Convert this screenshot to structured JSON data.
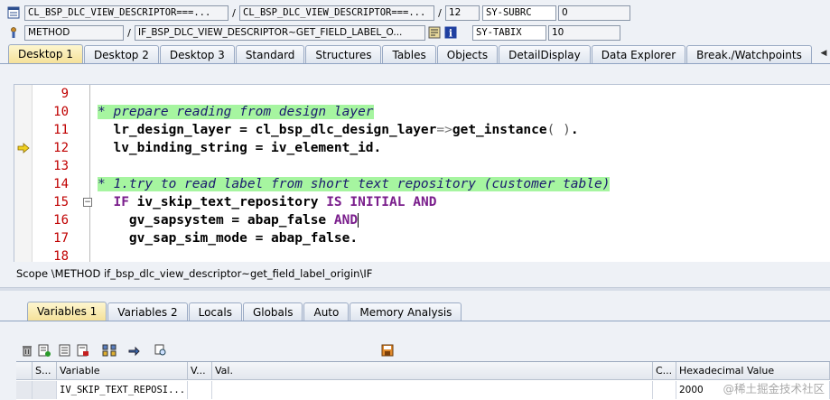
{
  "header": {
    "row1": {
      "program": "CL_BSP_DLC_VIEW_DESCRIPTOR===...",
      "include": "CL_BSP_DLC_VIEW_DESCRIPTOR===...",
      "line": "12",
      "var_name": "SY-SUBRC",
      "var_value": "0"
    },
    "row2": {
      "event_type": "METHOD",
      "event_name": "IF_BSP_DLC_VIEW_DESCRIPTOR~GET_FIELD_LABEL_O...",
      "var_name": "SY-TABIX",
      "var_value": "10"
    },
    "separator": "/"
  },
  "main_tabs": [
    {
      "label": "Desktop 1",
      "active": true
    },
    {
      "label": "Desktop 2",
      "active": false
    },
    {
      "label": "Desktop 3",
      "active": false
    },
    {
      "label": "Standard",
      "active": false
    },
    {
      "label": "Structures",
      "active": false
    },
    {
      "label": "Tables",
      "active": false
    },
    {
      "label": "Objects",
      "active": false
    },
    {
      "label": "DetailDisplay",
      "active": false
    },
    {
      "label": "Data Explorer",
      "active": false
    },
    {
      "label": "Break./Watchpoints",
      "active": false
    }
  ],
  "editor": {
    "lines": [
      {
        "num": "9",
        "text": ""
      },
      {
        "num": "10",
        "text": "* prepare reading from design layer"
      },
      {
        "num": "11",
        "text": "  lr_design_layer = cl_bsp_dlc_design_layer=>get_instance( )."
      },
      {
        "num": "12",
        "text": "  lv_binding_string = iv_element_id."
      },
      {
        "num": "13",
        "text": ""
      },
      {
        "num": "14",
        "text": "* 1.try to read label from short text repository (customer table)"
      },
      {
        "num": "15",
        "text": "  IF iv_skip_text_repository IS INITIAL AND"
      },
      {
        "num": "16",
        "text": "    gv_sapsystem = abap_false AND"
      },
      {
        "num": "17",
        "text": "    gv_sap_sim_mode = abap_false."
      },
      {
        "num": "18",
        "text": ""
      }
    ],
    "current_line": "12"
  },
  "scope": "Scope \\METHOD if_bsp_dlc_view_descriptor~get_field_label_origin\\IF",
  "bottom_tabs": [
    {
      "label": "Variables 1",
      "active": true
    },
    {
      "label": "Variables 2",
      "active": false
    },
    {
      "label": "Locals",
      "active": false
    },
    {
      "label": "Globals",
      "active": false
    },
    {
      "label": "Auto",
      "active": false
    },
    {
      "label": "Memory Analysis",
      "active": false
    }
  ],
  "grid": {
    "columns": [
      "S...",
      "Variable",
      "V...",
      "Val.",
      "C...",
      "Hexadecimal Value"
    ],
    "rows": [
      {
        "s": "",
        "variable": "IV_SKIP_TEXT_REPOSI...",
        "v": "",
        "val": "",
        "c": "",
        "hex": "2000"
      }
    ]
  },
  "watermark": "@稀土掘金技术社区",
  "colors": {
    "comment_bg": "#a6f5a0",
    "line_number": "#c00000",
    "keyword": "#7a1e8c",
    "active_tab": "#f5e19a"
  }
}
